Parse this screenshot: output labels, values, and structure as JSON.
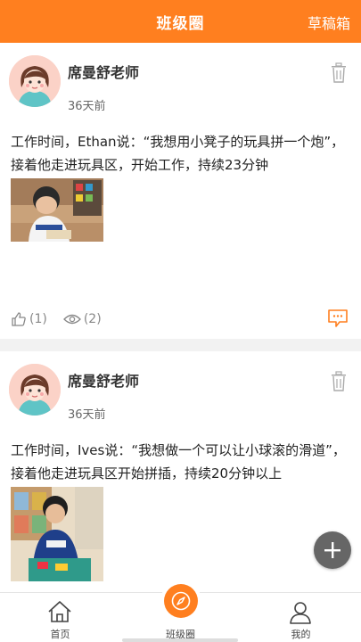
{
  "header": {
    "title": "班级圈",
    "drafts_label": "草稿箱"
  },
  "colors": {
    "accent": "#ff7f1f",
    "fab": "#666666"
  },
  "posts": [
    {
      "author": "席曼舒老师",
      "time": "36天前",
      "text": "工作时间，Ethan说：“我想用小凳子的玩具拼一个炮”，接着他走进玩具区，开始工作，持续23分钟",
      "likes": "(1)",
      "views": "(2)"
    },
    {
      "author": "席曼舒老师",
      "time": "36天前",
      "text": "工作时间，Ives说：“我想做一个可以让小球滚的滑道”，接着他走进玩具区开始拼插，持续20分钟以上"
    }
  ],
  "tabs": [
    {
      "label": "首页",
      "icon": "home-icon"
    },
    {
      "label": "班级圈",
      "icon": "compass-icon"
    },
    {
      "label": "我的",
      "icon": "user-icon"
    }
  ]
}
